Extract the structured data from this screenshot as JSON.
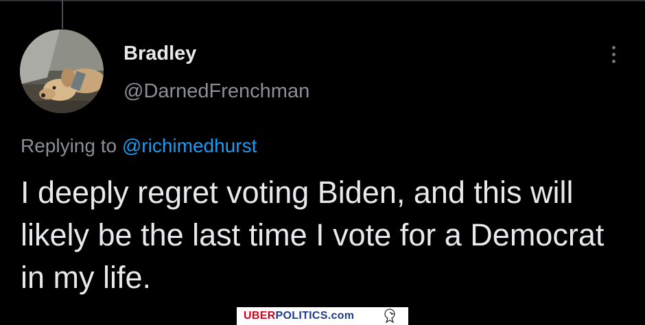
{
  "tweet": {
    "display_name": "Bradley",
    "handle": "@DarnedFrenchman",
    "replying_prefix": "Replying to",
    "replying_to": "@richimedhurst",
    "text": "I deeply regret voting Biden, and this will likely be the last time I vote for a Democrat in my life."
  },
  "icons": {
    "avatar": "dog-avatar",
    "more": "more-vertical-icon",
    "watermark_logo": "eagle-icon"
  },
  "watermark": {
    "part1": "UBER",
    "part2": "POLITICS",
    "part3": ".com"
  },
  "colors": {
    "background": "#000000",
    "text_primary": "#e7e9ea",
    "text_secondary": "#8b9096",
    "link": "#1d9bf0",
    "watermark_red": "#d0021b",
    "watermark_blue": "#1e3a8a"
  }
}
